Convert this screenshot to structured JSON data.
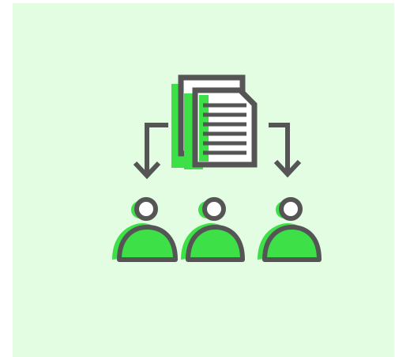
{
  "icon": {
    "name": "document-distribution-icon",
    "description_free": true
  },
  "colors": {
    "background": "#e2fde2",
    "accent": "#3ee048",
    "stroke": "#555555",
    "page": "#ffffff"
  },
  "people_count": 3
}
